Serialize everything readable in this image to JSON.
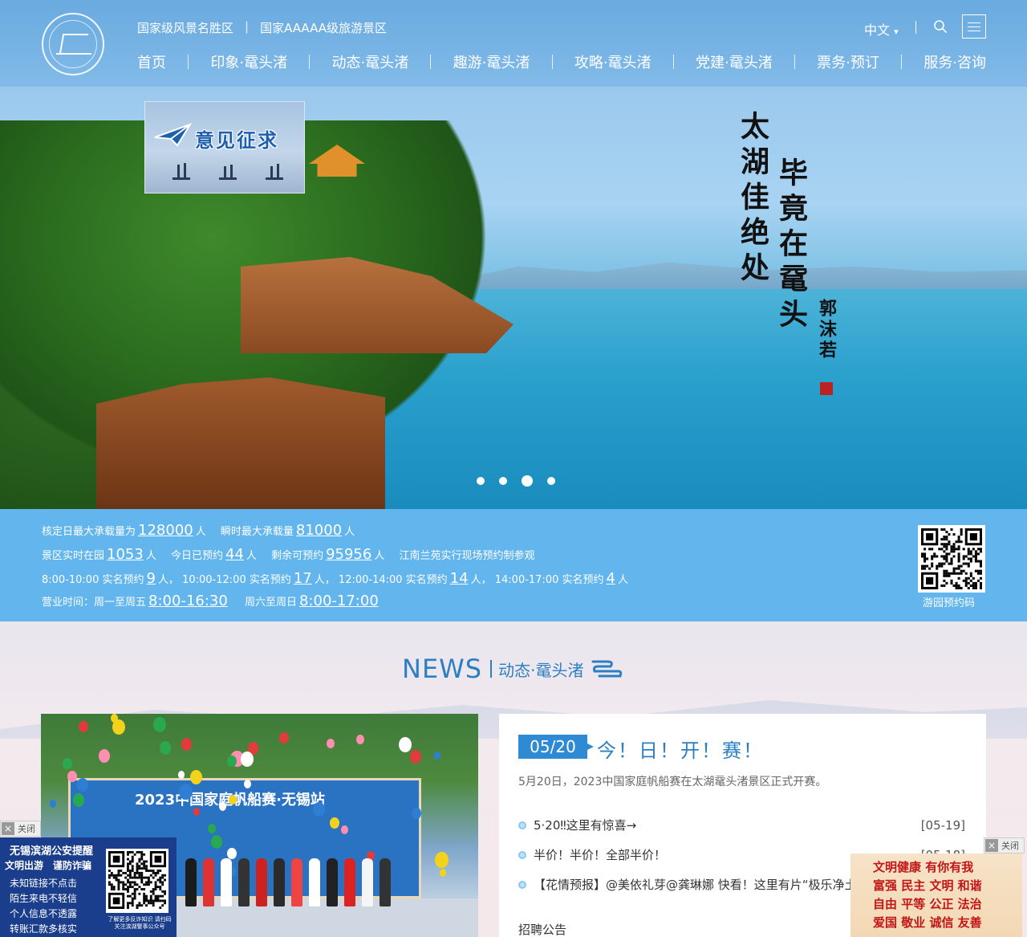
{
  "header": {
    "taglines": [
      "国家级风景名胜区",
      "国家AAAAA级旅游景区"
    ],
    "tagline_sep": "|",
    "nav": [
      "首页",
      "印象·鼋头渚",
      "动态·鼋头渚",
      "趣游·鼋头渚",
      "攻略·鼋头渚",
      "党建·鼋头渚",
      "票务·预订",
      "服务·咨询"
    ],
    "language": "中文",
    "language_caret": "▾",
    "language_sep": "|"
  },
  "hero": {
    "promo_title": "意见征求",
    "calligraphy_line1": "太湖佳绝处",
    "calligraphy_line2": "毕竟在鼋头",
    "calligraphy_signature": "郭沫若",
    "slide_count": 4,
    "active_slide": 3
  },
  "capacity": {
    "row1": {
      "l1": "核定日最大承载量为",
      "v1": "128000",
      "u1": "人",
      "l2": "瞬时最大承载量",
      "v2": "81000",
      "u2": "人"
    },
    "row2": {
      "l1": "景区实时在园",
      "v1": "1053",
      "u1": "人",
      "l2": "今日已预约",
      "v2": "44",
      "u2": "人",
      "l3": "剩余可预约",
      "v3": "95956",
      "u3": "人",
      "note": "江南兰苑实行现场预约制参观"
    },
    "row3": [
      {
        "label": "8:00-10:00 实名预约",
        "value": "9",
        "unit": "人，"
      },
      {
        "label": "10:00-12:00 实名预约",
        "value": "17",
        "unit": "人，"
      },
      {
        "label": "12:00-14:00 实名预约",
        "value": "14",
        "unit": "人，"
      },
      {
        "label": "14:00-17:00 实名预约",
        "value": "4",
        "unit": "人"
      }
    ],
    "row4": {
      "l0": "营业时间：",
      "l1": "周一至周五",
      "v1": "8:00-16:30",
      "l2": "周六至周日",
      "v2": "8:00-17:00"
    },
    "qr_label": "游园预约码"
  },
  "news": {
    "section_en": "NEWS",
    "section_cn": "动态·鼋头渚",
    "photo_banner": "2023中国家庭帆船赛·无锡站",
    "featured": {
      "date": "05/20",
      "title": "今！日！开！赛！",
      "summary": "5月20日，2023中国家庭帆船赛在太湖鼋头渚景区正式开赛。"
    },
    "items": [
      {
        "title": "5·20‼这里有惊喜→",
        "date": "[05-19]"
      },
      {
        "title": "半价！半价！全部半价！",
        "date": "[05-18]"
      },
      {
        "title": "【花情预报】@美依礼芽@龚琳娜 快看！这里有片“极乐净土”",
        "date": ""
      }
    ],
    "recruit": "招聘公告"
  },
  "ads": {
    "close_label": "关闭",
    "close_x": "×",
    "left_title": "无锡滨湖公安提醒",
    "left_subtitle": "文明出游　谨防诈骗",
    "left_poem": [
      "未知链接不点击",
      "陌生来电不轻信",
      "个人信息不透露",
      "转账汇款多核实"
    ],
    "left_small": "了解更多反诈知识 请扫码关注滨湖警事公众号",
    "right_lines": [
      "文明健康 有你有我",
      "富强 民主 文明 和谐",
      "自由 平等 公正 法治",
      "爱国 敬业 诚信 友善"
    ]
  }
}
